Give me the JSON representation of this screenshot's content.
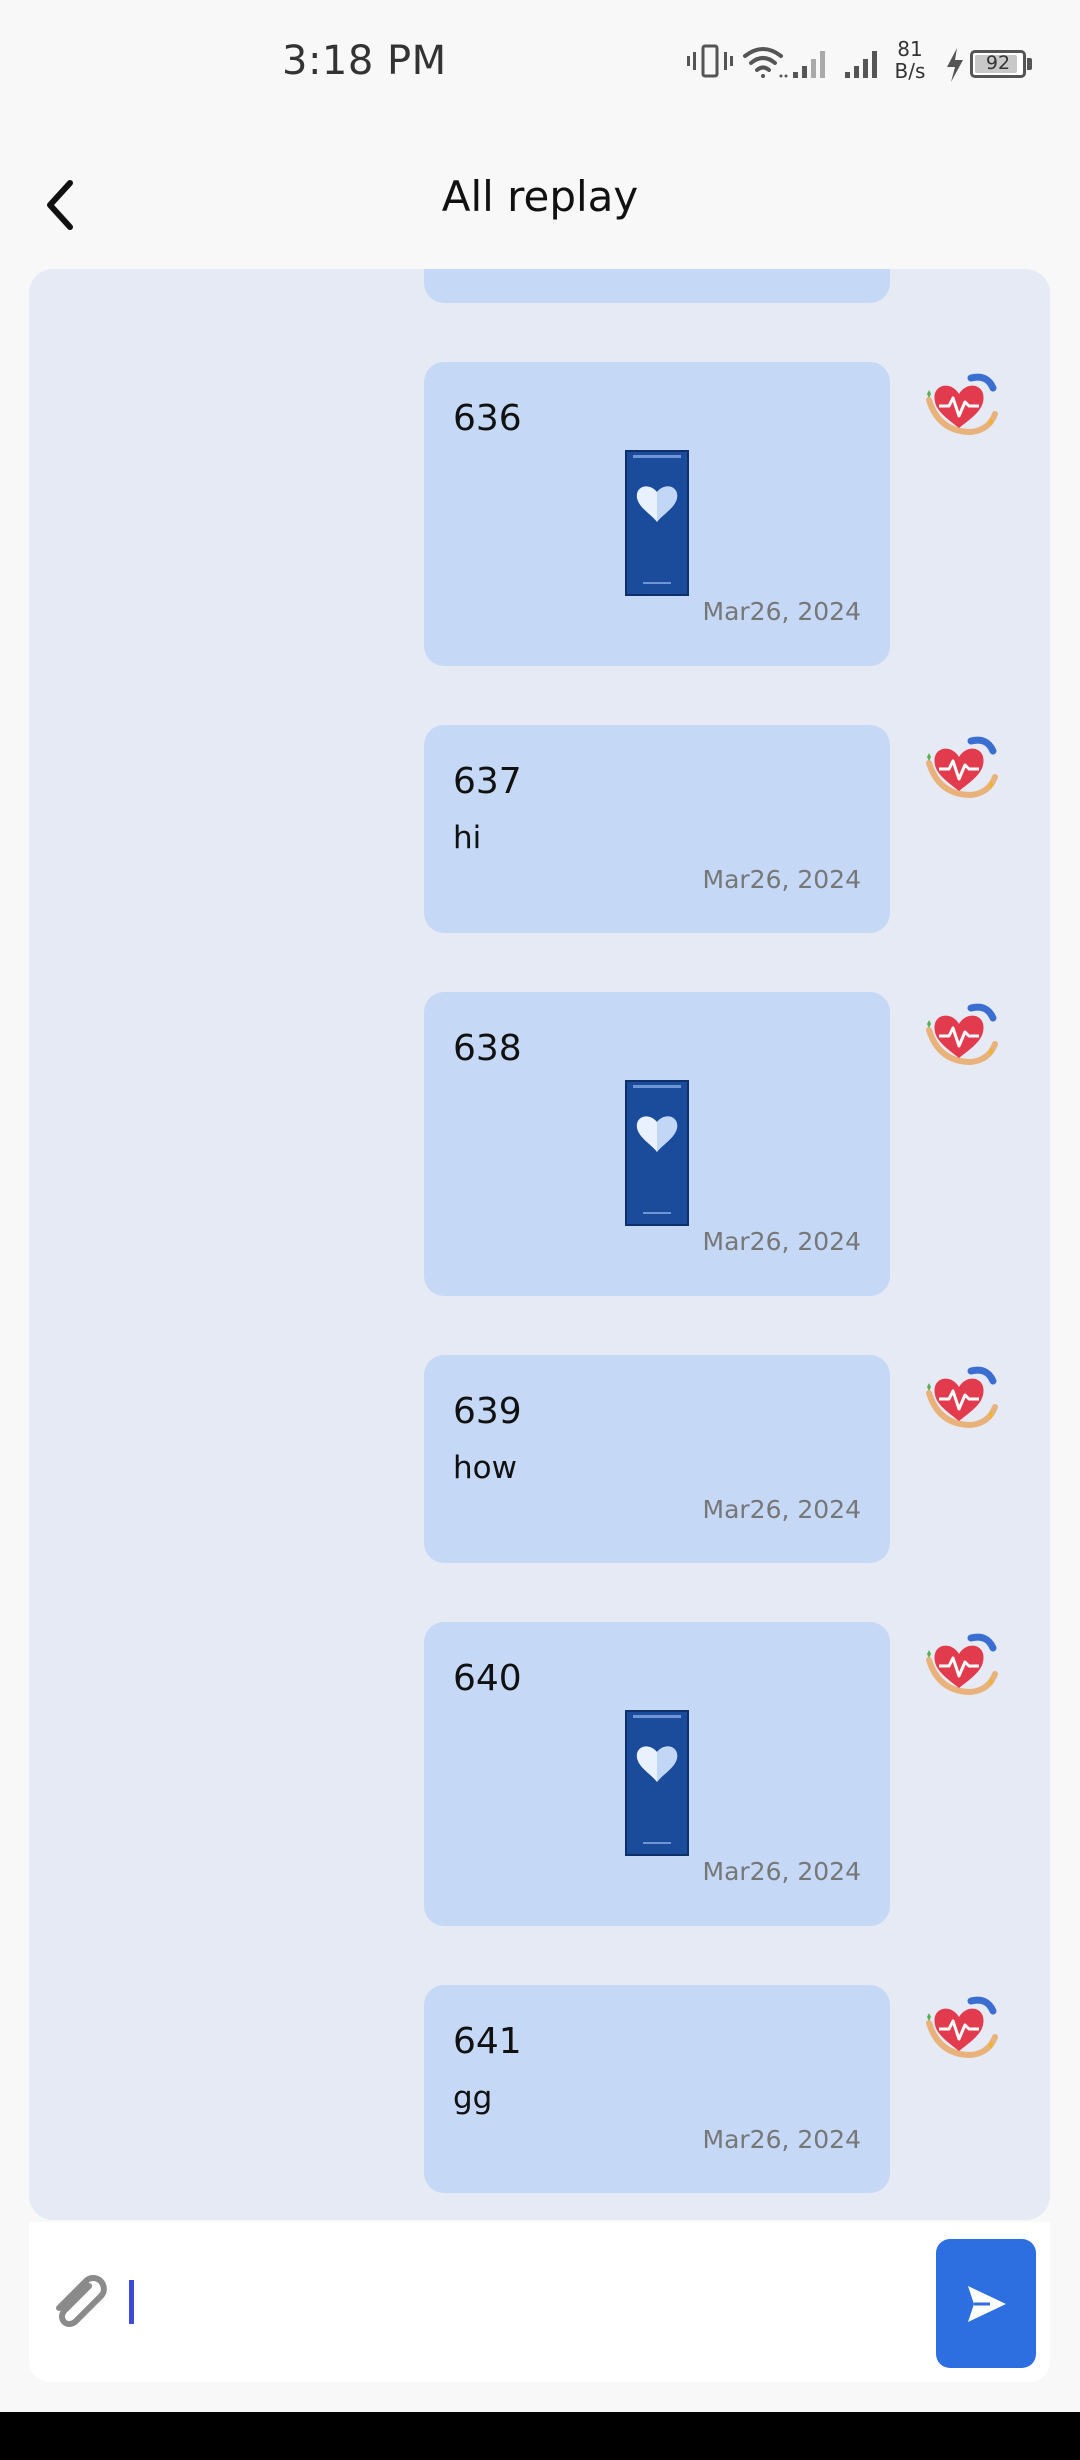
{
  "status_bar": {
    "time": "3:18 PM",
    "net_speed_value": "81",
    "net_speed_unit": "B/s",
    "battery": "92",
    "battery_level": 0.92,
    "icons": [
      "vibrate-icon",
      "wifi-icon",
      "signal-icon",
      "signal-icon",
      "charging-icon",
      "battery-icon"
    ]
  },
  "header": {
    "title": "All replay",
    "back_icon": "chevron-left-icon"
  },
  "messages": [
    {
      "id": "636",
      "type": "image",
      "date": "Mar26, 2024"
    },
    {
      "id": "637",
      "type": "text",
      "text": "hi",
      "date": "Mar26, 2024"
    },
    {
      "id": "638",
      "type": "image",
      "date": "Mar26, 2024"
    },
    {
      "id": "639",
      "type": "text",
      "text": "how",
      "date": "Mar26, 2024"
    },
    {
      "id": "640",
      "type": "image",
      "date": "Mar26, 2024"
    },
    {
      "id": "641",
      "type": "text",
      "text": "gg",
      "date": "Mar26, 2024"
    }
  ],
  "input_bar": {
    "value": "",
    "attach_icon": "paperclip-icon",
    "send_icon": "send-icon"
  },
  "colors": {
    "bubble": "#c5d8f6",
    "panel": "#e6eaf4",
    "send_button": "#2d6fe0",
    "caret": "#3d4bd6"
  }
}
